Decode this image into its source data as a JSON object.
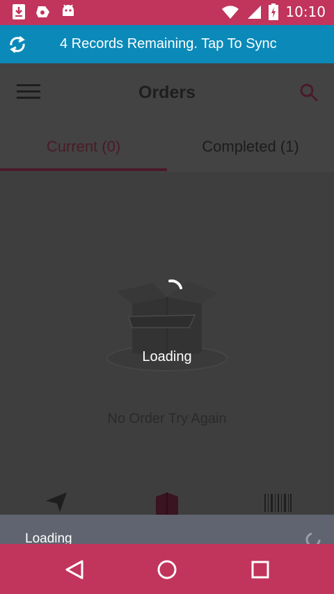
{
  "status_bar": {
    "time": "10:10",
    "left_icons": [
      "download-icon",
      "drive-icon",
      "android-icon"
    ],
    "right_icons": [
      "wifi-icon",
      "signal-icon",
      "battery-charging-icon"
    ]
  },
  "sync_banner": {
    "text": "4 Records Remaining. Tap To Sync",
    "icon": "sync-icon",
    "color": "#0b8ab9"
  },
  "app_bar": {
    "title": "Orders",
    "menu_icon": "hamburger-menu-icon",
    "search_icon": "search-icon"
  },
  "tabs": [
    {
      "label": "Current (0)",
      "selected": true
    },
    {
      "label": "Completed (1)",
      "selected": false
    }
  ],
  "empty_state": {
    "icon": "open-box-icon",
    "text": "No Order Try Again"
  },
  "loading_overlay": {
    "text": "Loading"
  },
  "bottom_nav": {
    "icons": [
      "navigation-arrow-icon",
      "box-icon",
      "barcode-icon"
    ]
  },
  "snackbar": {
    "text": "Loading"
  },
  "nav_bar": {
    "icons": [
      "back-icon",
      "home-icon",
      "recents-icon"
    ]
  },
  "colors": {
    "primary": "#c1345c",
    "banner": "#0b8ab9",
    "snackbar": "#5f6470"
  }
}
